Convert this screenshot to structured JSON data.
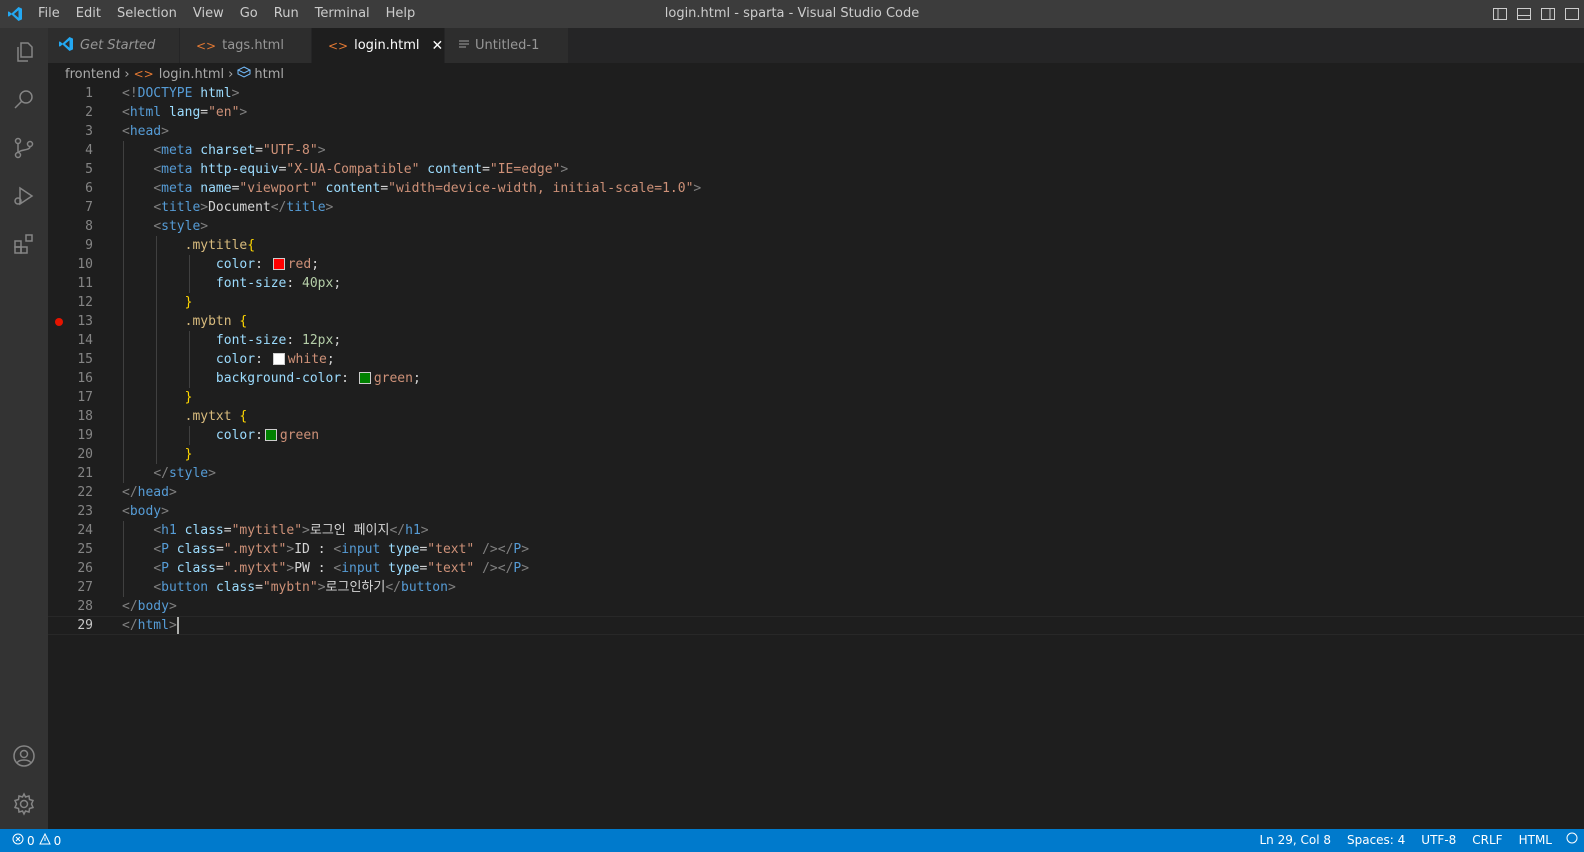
{
  "window": {
    "title": "login.html - sparta - Visual Studio Code"
  },
  "menu": [
    "File",
    "Edit",
    "Selection",
    "View",
    "Go",
    "Run",
    "Terminal",
    "Help"
  ],
  "tabs": [
    {
      "label": "Get Started",
      "icon": "vscode-logo-icon",
      "active": false
    },
    {
      "label": "tags.html",
      "icon": "html-file-icon",
      "active": false
    },
    {
      "label": "login.html",
      "icon": "html-file-icon",
      "active": true,
      "close": "✕"
    },
    {
      "label": "Untitled-1",
      "icon": "text-file-icon",
      "active": false
    }
  ],
  "breadcrumb": [
    "frontend",
    "login.html",
    "html"
  ],
  "editor": {
    "current_line": 29,
    "breakpoint_line": 13,
    "lines": [
      [
        [
          "t-br",
          "<!"
        ],
        [
          "t-tag",
          "DOCTYPE"
        ],
        [
          "t-txt",
          " "
        ],
        [
          "t-attr",
          "html"
        ],
        [
          "t-br",
          ">"
        ]
      ],
      [
        [
          "t-br",
          "<"
        ],
        [
          "t-tag",
          "html"
        ],
        [
          "t-txt",
          " "
        ],
        [
          "t-attr",
          "lang"
        ],
        [
          "t-txt",
          "="
        ],
        [
          "t-str",
          "\"en\""
        ],
        [
          "t-br",
          ">"
        ]
      ],
      [
        [
          "t-br",
          "<"
        ],
        [
          "t-tag",
          "head"
        ],
        [
          "t-br",
          ">"
        ]
      ],
      [
        [
          "t-txt",
          "    "
        ],
        [
          "t-br",
          "<"
        ],
        [
          "t-tag",
          "meta"
        ],
        [
          "t-txt",
          " "
        ],
        [
          "t-attr",
          "charset"
        ],
        [
          "t-txt",
          "="
        ],
        [
          "t-str",
          "\"UTF-8\""
        ],
        [
          "t-br",
          ">"
        ]
      ],
      [
        [
          "t-txt",
          "    "
        ],
        [
          "t-br",
          "<"
        ],
        [
          "t-tag",
          "meta"
        ],
        [
          "t-txt",
          " "
        ],
        [
          "t-attr",
          "http-equiv"
        ],
        [
          "t-txt",
          "="
        ],
        [
          "t-str",
          "\"X-UA-Compatible\""
        ],
        [
          "t-txt",
          " "
        ],
        [
          "t-attr",
          "content"
        ],
        [
          "t-txt",
          "="
        ],
        [
          "t-str",
          "\"IE=edge\""
        ],
        [
          "t-br",
          ">"
        ]
      ],
      [
        [
          "t-txt",
          "    "
        ],
        [
          "t-br",
          "<"
        ],
        [
          "t-tag",
          "meta"
        ],
        [
          "t-txt",
          " "
        ],
        [
          "t-attr",
          "name"
        ],
        [
          "t-txt",
          "="
        ],
        [
          "t-str",
          "\"viewport\""
        ],
        [
          "t-txt",
          " "
        ],
        [
          "t-attr",
          "content"
        ],
        [
          "t-txt",
          "="
        ],
        [
          "t-str",
          "\"width=device-width, initial-scale=1.0\""
        ],
        [
          "t-br",
          ">"
        ]
      ],
      [
        [
          "t-txt",
          "    "
        ],
        [
          "t-br",
          "<"
        ],
        [
          "t-tag",
          "title"
        ],
        [
          "t-br",
          ">"
        ],
        [
          "t-txt",
          "Document"
        ],
        [
          "t-br",
          "</"
        ],
        [
          "t-tag",
          "title"
        ],
        [
          "t-br",
          ">"
        ]
      ],
      [
        [
          "t-txt",
          "    "
        ],
        [
          "t-br",
          "<"
        ],
        [
          "t-tag",
          "style"
        ],
        [
          "t-br",
          ">"
        ]
      ],
      [
        [
          "t-txt",
          "        "
        ],
        [
          "t-sel",
          ".mytitle"
        ],
        [
          "t-brace",
          "{"
        ]
      ],
      [
        [
          "t-txt",
          "            "
        ],
        [
          "t-attr",
          "color"
        ],
        [
          "t-txt",
          ": "
        ],
        [
          "swatch",
          "#ff0000"
        ],
        [
          "t-str",
          "red"
        ],
        [
          "t-txt",
          ";"
        ]
      ],
      [
        [
          "t-txt",
          "            "
        ],
        [
          "t-attr",
          "font-size"
        ],
        [
          "t-txt",
          ": "
        ],
        [
          "t-num",
          "40px"
        ],
        [
          "t-txt",
          ";"
        ]
      ],
      [
        [
          "t-txt",
          "        "
        ],
        [
          "t-brace",
          "}"
        ]
      ],
      [
        [
          "t-txt",
          "        "
        ],
        [
          "t-sel",
          ".mybtn"
        ],
        [
          "t-txt",
          " "
        ],
        [
          "t-brace",
          "{"
        ]
      ],
      [
        [
          "t-txt",
          "            "
        ],
        [
          "t-attr",
          "font-size"
        ],
        [
          "t-txt",
          ": "
        ],
        [
          "t-num",
          "12px"
        ],
        [
          "t-txt",
          ";"
        ]
      ],
      [
        [
          "t-txt",
          "            "
        ],
        [
          "t-attr",
          "color"
        ],
        [
          "t-txt",
          ": "
        ],
        [
          "swatch",
          "#ffffff"
        ],
        [
          "t-str",
          "white"
        ],
        [
          "t-txt",
          ";"
        ]
      ],
      [
        [
          "t-txt",
          "            "
        ],
        [
          "t-attr",
          "background-color"
        ],
        [
          "t-txt",
          ": "
        ],
        [
          "swatch",
          "#008000"
        ],
        [
          "t-str",
          "green"
        ],
        [
          "t-txt",
          ";"
        ]
      ],
      [
        [
          "t-txt",
          "        "
        ],
        [
          "t-brace",
          "}"
        ]
      ],
      [
        [
          "t-txt",
          "        "
        ],
        [
          "t-sel",
          ".mytxt"
        ],
        [
          "t-txt",
          " "
        ],
        [
          "t-brace",
          "{"
        ]
      ],
      [
        [
          "t-txt",
          "            "
        ],
        [
          "t-attr",
          "color"
        ],
        [
          "t-txt",
          ":"
        ],
        [
          "swatch",
          "#008000"
        ],
        [
          "t-str",
          "green"
        ]
      ],
      [
        [
          "t-txt",
          "        "
        ],
        [
          "t-brace",
          "}"
        ]
      ],
      [
        [
          "t-txt",
          "    "
        ],
        [
          "t-br",
          "</"
        ],
        [
          "t-tag",
          "style"
        ],
        [
          "t-br",
          ">"
        ]
      ],
      [
        [
          "t-br",
          "</"
        ],
        [
          "t-tag",
          "head"
        ],
        [
          "t-br",
          ">"
        ]
      ],
      [
        [
          "t-br",
          "<"
        ],
        [
          "t-tag",
          "body"
        ],
        [
          "t-br",
          ">"
        ]
      ],
      [
        [
          "t-txt",
          "    "
        ],
        [
          "t-br",
          "<"
        ],
        [
          "t-tag",
          "h1"
        ],
        [
          "t-txt",
          " "
        ],
        [
          "t-attr",
          "class"
        ],
        [
          "t-txt",
          "="
        ],
        [
          "t-str",
          "\"mytitle\""
        ],
        [
          "t-br",
          ">"
        ],
        [
          "t-txt",
          "로그인 페이지"
        ],
        [
          "t-br",
          "</"
        ],
        [
          "t-tag",
          "h1"
        ],
        [
          "t-br",
          ">"
        ]
      ],
      [
        [
          "t-txt",
          "    "
        ],
        [
          "t-br",
          "<"
        ],
        [
          "t-tag",
          "P"
        ],
        [
          "t-txt",
          " "
        ],
        [
          "t-attr",
          "class"
        ],
        [
          "t-txt",
          "="
        ],
        [
          "t-str",
          "\".mytxt\""
        ],
        [
          "t-br",
          ">"
        ],
        [
          "t-txt",
          "ID : "
        ],
        [
          "t-br",
          "<"
        ],
        [
          "t-tag",
          "input"
        ],
        [
          "t-txt",
          " "
        ],
        [
          "t-attr",
          "type"
        ],
        [
          "t-txt",
          "="
        ],
        [
          "t-str",
          "\"text\""
        ],
        [
          "t-txt",
          " "
        ],
        [
          "t-br",
          "/>"
        ],
        [
          "t-br",
          "</"
        ],
        [
          "t-tag",
          "P"
        ],
        [
          "t-br",
          ">"
        ]
      ],
      [
        [
          "t-txt",
          "    "
        ],
        [
          "t-br",
          "<"
        ],
        [
          "t-tag",
          "P"
        ],
        [
          "t-txt",
          " "
        ],
        [
          "t-attr",
          "class"
        ],
        [
          "t-txt",
          "="
        ],
        [
          "t-str",
          "\".mytxt\""
        ],
        [
          "t-br",
          ">"
        ],
        [
          "t-txt",
          "PW : "
        ],
        [
          "t-br",
          "<"
        ],
        [
          "t-tag",
          "input"
        ],
        [
          "t-txt",
          " "
        ],
        [
          "t-attr",
          "type"
        ],
        [
          "t-txt",
          "="
        ],
        [
          "t-str",
          "\"text\""
        ],
        [
          "t-txt",
          " "
        ],
        [
          "t-br",
          "/>"
        ],
        [
          "t-br",
          "</"
        ],
        [
          "t-tag",
          "P"
        ],
        [
          "t-br",
          ">"
        ]
      ],
      [
        [
          "t-txt",
          "    "
        ],
        [
          "t-br",
          "<"
        ],
        [
          "t-tag",
          "button"
        ],
        [
          "t-txt",
          " "
        ],
        [
          "t-attr",
          "class"
        ],
        [
          "t-txt",
          "="
        ],
        [
          "t-str",
          "\"mybtn\""
        ],
        [
          "t-br",
          ">"
        ],
        [
          "t-txt",
          "로그인하기"
        ],
        [
          "t-br",
          "</"
        ],
        [
          "t-tag",
          "button"
        ],
        [
          "t-br",
          ">"
        ]
      ],
      [
        [
          "t-br",
          "</"
        ],
        [
          "t-tag",
          "body"
        ],
        [
          "t-br",
          ">"
        ]
      ],
      [
        [
          "t-br",
          "</"
        ],
        [
          "t-tag",
          "html"
        ],
        [
          "t-br",
          ">"
        ],
        [
          "cursor",
          ""
        ]
      ]
    ]
  },
  "status": {
    "errors": "0",
    "warnings": "0",
    "position": "Ln 29, Col 8",
    "spaces": "Spaces: 4",
    "encoding": "UTF-8",
    "eol": "CRLF",
    "language": "HTML"
  }
}
